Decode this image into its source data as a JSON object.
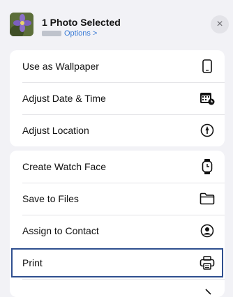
{
  "header": {
    "title": "1 Photo Selected",
    "options_label": "Options >",
    "close_label": "×"
  },
  "group1": [
    {
      "label": "Use as Wallpaper",
      "icon": "phone-icon"
    },
    {
      "label": "Adjust Date & Time",
      "icon": "calendar-clock-icon"
    },
    {
      "label": "Adjust Location",
      "icon": "location-icon"
    }
  ],
  "group2": [
    {
      "label": "Create Watch Face",
      "icon": "watch-icon"
    },
    {
      "label": "Save to Files",
      "icon": "folder-icon"
    },
    {
      "label": "Assign to Contact",
      "icon": "contact-icon"
    },
    {
      "label": "Print",
      "icon": "printer-icon"
    }
  ],
  "colors": {
    "accent": "#3a7bd5",
    "highlight_border": "#2f4f8f"
  }
}
